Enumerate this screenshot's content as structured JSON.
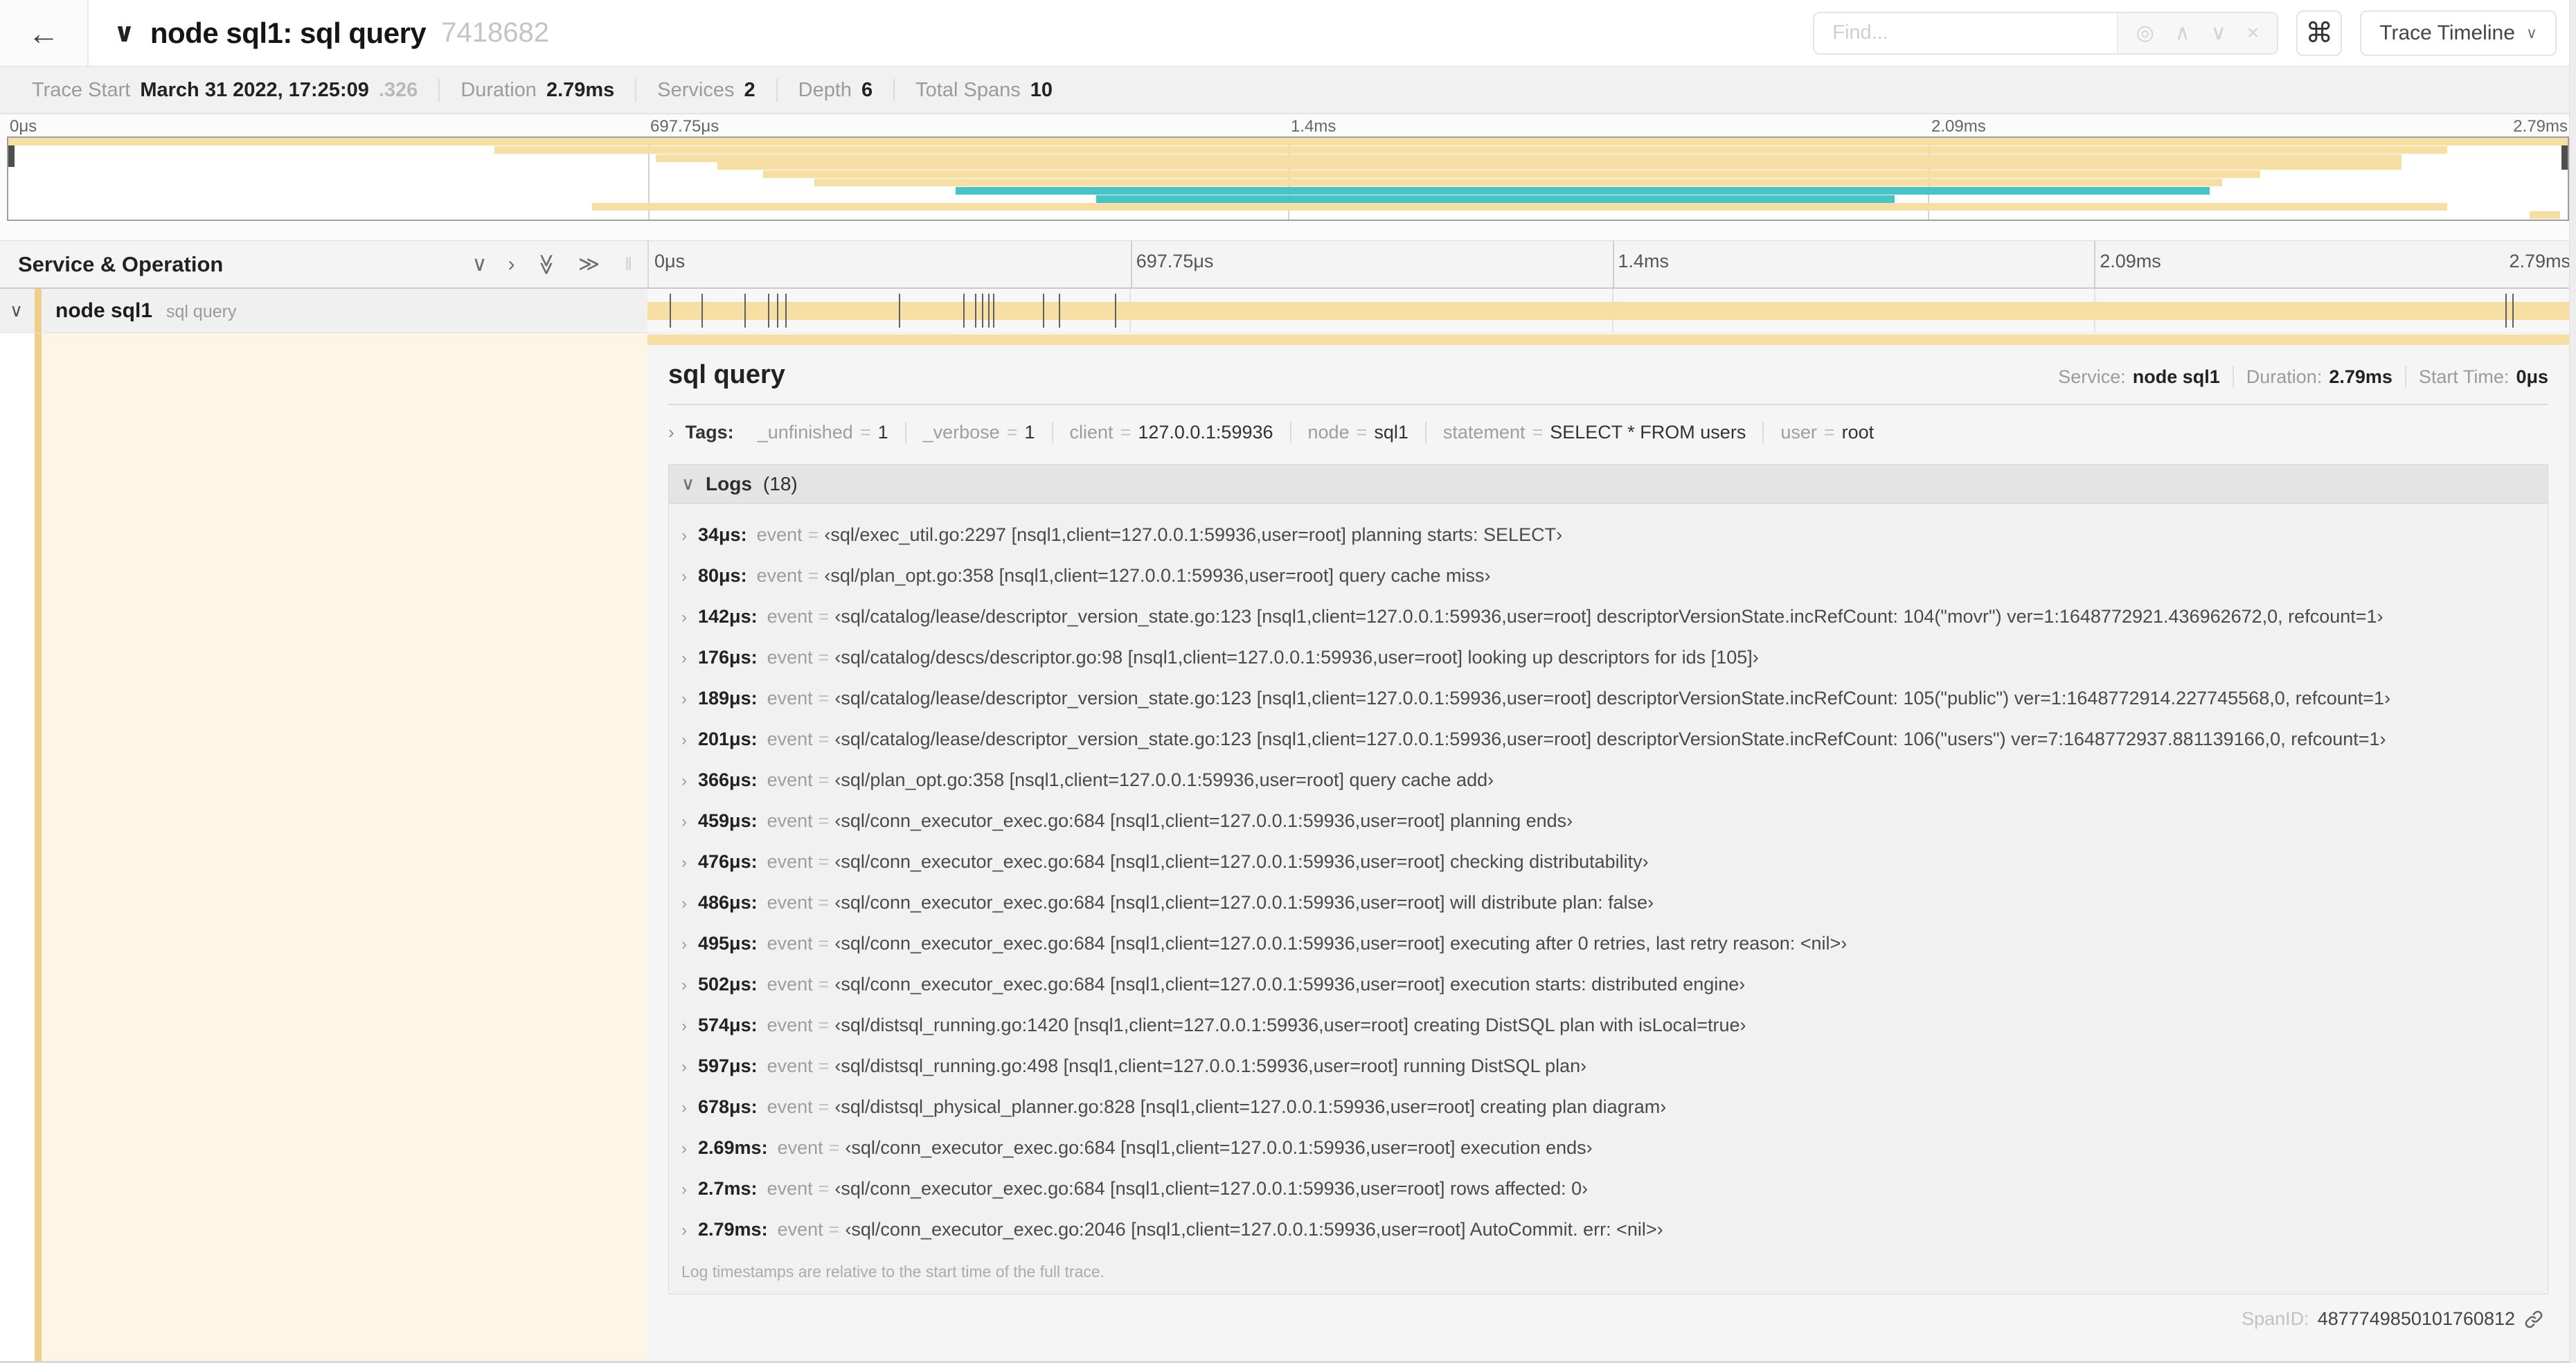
{
  "icons": {
    "back": "←",
    "chevron_down": "∨",
    "chevron_right": "›",
    "double_chevron": "≫",
    "grip": "‖",
    "command": "⌘",
    "crosshair": "◎",
    "up": "∧",
    "down": "∨",
    "close": "×"
  },
  "colors": {
    "tan": "#f7dfa4",
    "tan_stripe": "#f1cf8b",
    "cream": "#fdf6e7",
    "teal": "#46c5c8"
  },
  "header": {
    "title": "node sql1: sql query",
    "trace_id": "7418682",
    "find_placeholder": "Find...",
    "view_selector": "Trace Timeline"
  },
  "stats": [
    {
      "label": "Trace Start",
      "value": "March 31 2022, 17:25:09",
      "suffix": ".326"
    },
    {
      "label": "Duration",
      "value": "2.79ms",
      "suffix": ""
    },
    {
      "label": "Services",
      "value": "2",
      "suffix": ""
    },
    {
      "label": "Depth",
      "value": "6",
      "suffix": ""
    },
    {
      "label": "Total Spans",
      "value": "10",
      "suffix": ""
    }
  ],
  "axis": [
    {
      "text": "0μs",
      "pct": 0
    },
    {
      "text": "697.75μs",
      "pct": 25
    },
    {
      "text": "1.4ms",
      "pct": 50
    },
    {
      "text": "2.09ms",
      "pct": 75
    },
    {
      "text": "2.79ms",
      "pct": 100
    }
  ],
  "minimap": {
    "rows": [
      {
        "start": 0,
        "end": 100,
        "color": "tan"
      },
      {
        "start": 19,
        "end": 95.3,
        "color": "tan"
      },
      {
        "start": 25.3,
        "end": 93.5,
        "color": "tan"
      },
      {
        "start": 27.7,
        "end": 93.5,
        "color": "tan"
      },
      {
        "start": 29.5,
        "end": 88,
        "color": "tan"
      },
      {
        "start": 31.5,
        "end": 86.5,
        "color": "tan"
      },
      {
        "start": 37,
        "end": 86,
        "color": "teal"
      },
      {
        "start": 42.5,
        "end": 73.7,
        "color": "teal"
      },
      {
        "start": 22.8,
        "end": 95.3,
        "color": "tan"
      },
      {
        "start": 98.5,
        "end": 99.7,
        "color": "tan"
      }
    ]
  },
  "timeline_header": {
    "title": "Service & Operation"
  },
  "span_row": {
    "service": "node sql1",
    "operation": "sql query"
  },
  "trace": {
    "duration_us": 2790
  },
  "detail": {
    "title": "sql query",
    "meta": [
      {
        "label": "Service:",
        "value": "node sql1"
      },
      {
        "label": "Duration:",
        "value": "2.79ms"
      },
      {
        "label": "Start Time:",
        "value": "0μs"
      }
    ],
    "tags_label": "Tags:",
    "tag_eq": "=",
    "tags": [
      {
        "key": "_unfinished",
        "value": "1"
      },
      {
        "key": "_verbose",
        "value": "1"
      },
      {
        "key": "client",
        "value": "127.0.0.1:59936"
      },
      {
        "key": "node",
        "value": "sql1"
      },
      {
        "key": "statement",
        "value": "SELECT * FROM users"
      },
      {
        "key": "user",
        "value": "root"
      }
    ],
    "logs": {
      "title": "Logs",
      "count": "(18)",
      "field_key": "event",
      "eq": "=",
      "bracket_open": "‹",
      "bracket_close": "›",
      "entries": [
        {
          "time": "34μs:",
          "time_us": 34,
          "event": "sql/exec_util.go:2297 [nsql1,client=127.0.0.1:59936,user=root] planning starts: SELECT"
        },
        {
          "time": "80μs:",
          "time_us": 80,
          "event": "sql/plan_opt.go:358 [nsql1,client=127.0.0.1:59936,user=root] query cache miss"
        },
        {
          "time": "142μs:",
          "time_us": 142,
          "event": "sql/catalog/lease/descriptor_version_state.go:123 [nsql1,client=127.0.0.1:59936,user=root] descriptorVersionState.incRefCount: 104(\"movr\") ver=1:1648772921.436962672,0, refcount=1"
        },
        {
          "time": "176μs:",
          "time_us": 176,
          "event": "sql/catalog/descs/descriptor.go:98 [nsql1,client=127.0.0.1:59936,user=root] looking up descriptors for ids [105]"
        },
        {
          "time": "189μs:",
          "time_us": 189,
          "event": "sql/catalog/lease/descriptor_version_state.go:123 [nsql1,client=127.0.0.1:59936,user=root] descriptorVersionState.incRefCount: 105(\"public\") ver=1:1648772914.227745568,0, refcount=1"
        },
        {
          "time": "201μs:",
          "time_us": 201,
          "event": "sql/catalog/lease/descriptor_version_state.go:123 [nsql1,client=127.0.0.1:59936,user=root] descriptorVersionState.incRefCount: 106(\"users\") ver=7:1648772937.881139166,0, refcount=1"
        },
        {
          "time": "366μs:",
          "time_us": 366,
          "event": "sql/plan_opt.go:358 [nsql1,client=127.0.0.1:59936,user=root] query cache add"
        },
        {
          "time": "459μs:",
          "time_us": 459,
          "event": "sql/conn_executor_exec.go:684 [nsql1,client=127.0.0.1:59936,user=root] planning ends"
        },
        {
          "time": "476μs:",
          "time_us": 476,
          "event": "sql/conn_executor_exec.go:684 [nsql1,client=127.0.0.1:59936,user=root] checking distributability"
        },
        {
          "time": "486μs:",
          "time_us": 486,
          "event": "sql/conn_executor_exec.go:684 [nsql1,client=127.0.0.1:59936,user=root] will distribute plan: false"
        },
        {
          "time": "495μs:",
          "time_us": 495,
          "event": "sql/conn_executor_exec.go:684 [nsql1,client=127.0.0.1:59936,user=root] executing after 0 retries, last retry reason: <nil>"
        },
        {
          "time": "502μs:",
          "time_us": 502,
          "event": "sql/conn_executor_exec.go:684 [nsql1,client=127.0.0.1:59936,user=root] execution starts: distributed engine"
        },
        {
          "time": "574μs:",
          "time_us": 574,
          "event": "sql/distsql_running.go:1420 [nsql1,client=127.0.0.1:59936,user=root] creating DistSQL plan with isLocal=true"
        },
        {
          "time": "597μs:",
          "time_us": 597,
          "event": "sql/distsql_running.go:498 [nsql1,client=127.0.0.1:59936,user=root] running DistSQL plan"
        },
        {
          "time": "678μs:",
          "time_us": 678,
          "event": "sql/distsql_physical_planner.go:828 [nsql1,client=127.0.0.1:59936,user=root] creating plan diagram"
        },
        {
          "time": "2.69ms:",
          "time_us": 2690,
          "event": "sql/conn_executor_exec.go:684 [nsql1,client=127.0.0.1:59936,user=root] execution ends"
        },
        {
          "time": "2.7ms:",
          "time_us": 2700,
          "event": "sql/conn_executor_exec.go:684 [nsql1,client=127.0.0.1:59936,user=root] rows affected: 0"
        },
        {
          "time": "2.79ms:",
          "time_us": 2790,
          "event": "sql/conn_executor_exec.go:2046 [nsql1,client=127.0.0.1:59936,user=root] AutoCommit. err: <nil>"
        }
      ],
      "footer": "Log timestamps are relative to the start time of the full trace."
    },
    "span_id_label": "SpanID:",
    "span_id": "4877749850101760812"
  }
}
